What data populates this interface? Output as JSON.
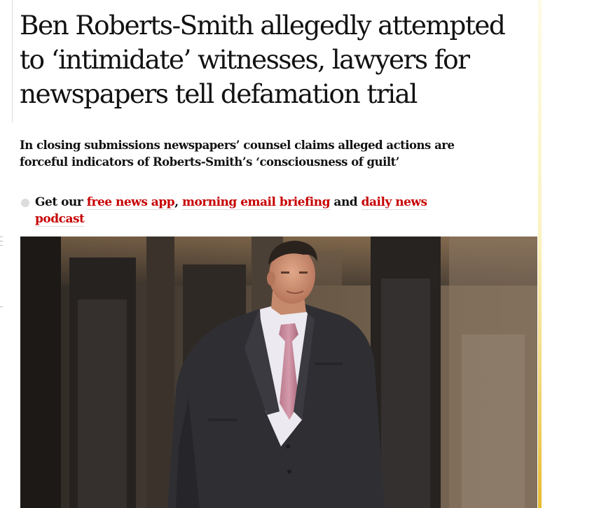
{
  "article": {
    "headline": "Ben Roberts-Smith allegedly attempted to ‘intimidate’ witnesses, lawyers for newspapers tell defamation trial",
    "standfirst": "In closing submissions newspapers’ counsel claims alleged actions are forceful indicators of Roberts-Smith’s ‘consciousness of guilt’",
    "promo": {
      "prefix": "Get our ",
      "link1": "free news app",
      "sep1": ", ",
      "link2": "morning email briefing",
      "sep2": " and ",
      "link3": "daily news podcast"
    }
  },
  "colors": {
    "link": "#c70000",
    "text": "#121212",
    "bullet": "#dcdcdc"
  }
}
